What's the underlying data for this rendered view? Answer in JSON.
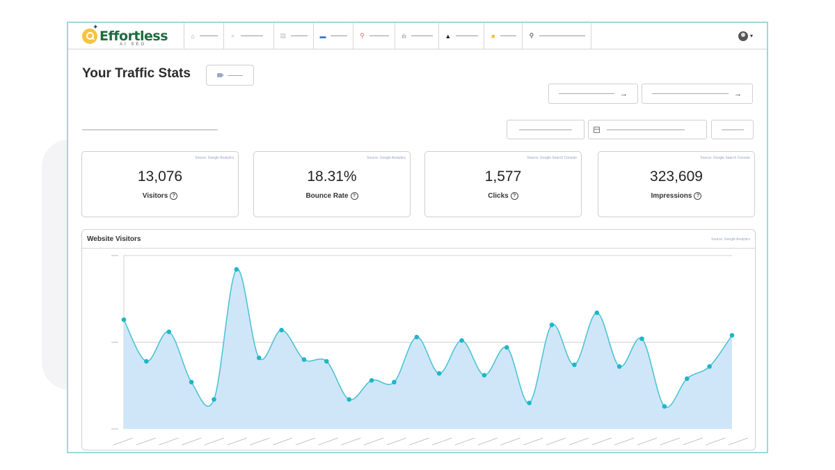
{
  "app": {
    "logo_text": "Effortless",
    "logo_subtitle": "AI SEO"
  },
  "nav": {
    "items": [
      {
        "icon": "home-icon",
        "color": "#8a9bc5"
      },
      {
        "icon": "search-zoom-icon",
        "color": "#7cb6d8"
      },
      {
        "icon": "document-icon",
        "color": "#b9b9b9"
      },
      {
        "icon": "storefront-icon",
        "color": "#3b6fd1"
      },
      {
        "icon": "key-icon",
        "color": "#e06a6a"
      },
      {
        "icon": "bar-chart-icon",
        "color": "#8a8a8a"
      },
      {
        "icon": "graduation-cap-icon",
        "color": "#222222"
      },
      {
        "icon": "folder-icon",
        "color": "#f2c237"
      },
      {
        "icon": "magnifier-icon",
        "color": "#333333"
      }
    ],
    "user_icon": "user-avatar-icon"
  },
  "header": {
    "title": "Your Traffic Stats",
    "video_icon": "video-camera-icon",
    "arrow": "→"
  },
  "stats": [
    {
      "source": "Source: Google Analytics",
      "value": "13,076",
      "label": "Visitors"
    },
    {
      "source": "Source: Google Analytics",
      "value": "18.31%",
      "label": "Bounce Rate"
    },
    {
      "source": "Source: Google Search Console",
      "value": "1,577",
      "label": "Clicks"
    },
    {
      "source": "Source: Google Search Console",
      "value": "323,609",
      "label": "Impressions"
    }
  ],
  "help_glyph": "?",
  "chart": {
    "title": "Website Visitors",
    "source": "Source: Google Analytics",
    "line_color": "#4ec3d3",
    "fill_color": "#cfe6f8",
    "point_color": "#1fb6c9"
  },
  "chart_data": {
    "type": "area",
    "ylim": [
      0,
      100
    ],
    "grid": true,
    "series": [
      {
        "values": [
          63,
          39,
          56,
          27,
          17,
          92,
          41,
          57,
          40,
          39,
          17,
          28,
          27,
          53,
          32,
          51,
          31,
          47,
          15,
          60,
          37,
          67,
          36,
          52,
          13,
          29,
          36,
          54
        ]
      }
    ]
  }
}
